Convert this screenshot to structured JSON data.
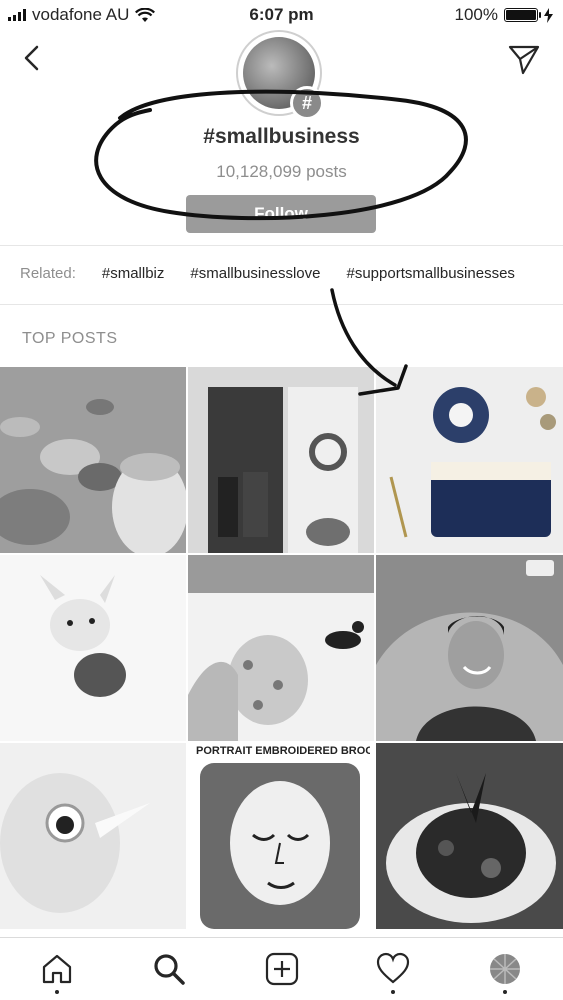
{
  "status_bar": {
    "carrier": "vodafone AU",
    "time": "6:07 pm",
    "battery": "100%"
  },
  "header": {
    "hashtag": "#smallbusiness",
    "posts_count": "10,128,099 posts",
    "follow_label": "Follow",
    "badge_symbol": "#"
  },
  "related": {
    "label": "Related:",
    "tags": [
      "#smallbiz",
      "#smallbusinesslove",
      "#supportsmallbusinesses"
    ]
  },
  "section_title": "TOP POSTS",
  "grid": {
    "caption_post_8": "PORTRAIT EMBROIDERED BROOCHES"
  },
  "icons": {
    "back": "chevron-left-icon",
    "share": "paper-plane-icon",
    "home": "home-icon",
    "search": "search-icon",
    "add": "plus-square-icon",
    "activity": "heart-icon",
    "profile": "profile-avatar"
  },
  "colors": {
    "follow_bg": "#9b9b9b",
    "secondary_text": "#8e8e8e",
    "primary_text": "#262626"
  }
}
